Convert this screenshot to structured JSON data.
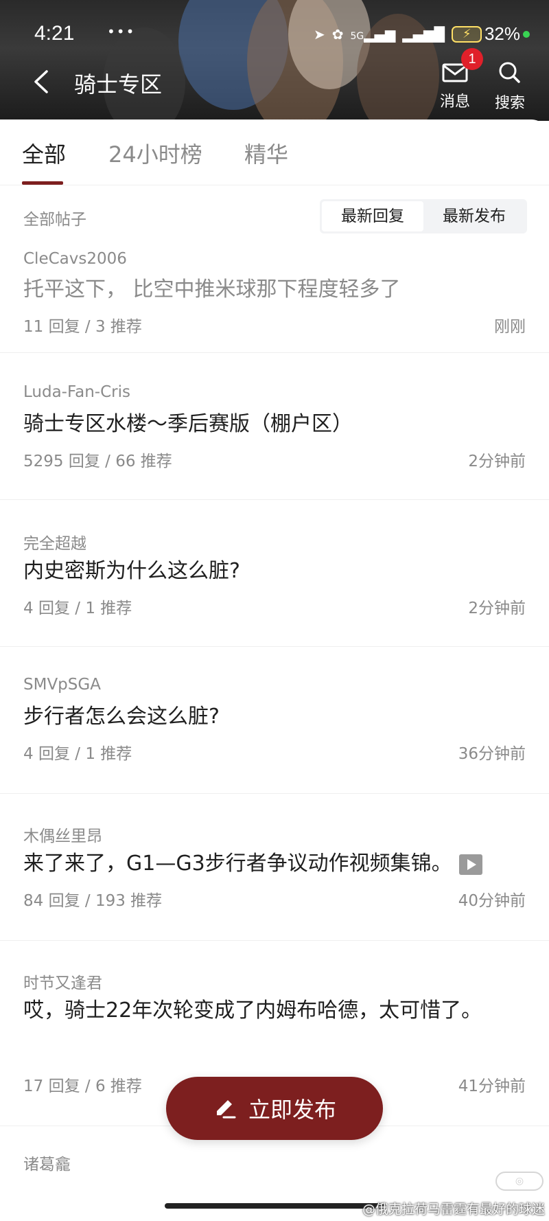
{
  "status_bar": {
    "time": "4:21",
    "dots": "•••",
    "network_label": "5G",
    "battery_percent": "32%"
  },
  "header": {
    "back_icon": "chevron-left-icon",
    "title": "骑士专区",
    "message_label": "消息",
    "message_badge": "1",
    "search_label": "搜索"
  },
  "tabs": [
    {
      "label": "全部",
      "active": true
    },
    {
      "label": "24小时榜",
      "active": false
    },
    {
      "label": "精华",
      "active": false
    }
  ],
  "filter": {
    "label": "全部帖子",
    "options": [
      "最新回复",
      "最新发布"
    ],
    "selected": "最新回复"
  },
  "posts": [
    {
      "author": "CleCavs2006",
      "title": "托平这下， 比空中推米球那下程度轻多了",
      "stats": "11 回复 / 3 推荐",
      "time": "刚刚",
      "read": true
    },
    {
      "author": "Luda-Fan-Cris",
      "title": "骑士专区水楼～季后赛版（棚户区）",
      "stats": "5295 回复 / 66 推荐",
      "time": "2分钟前",
      "read": false
    },
    {
      "author": "完全超越",
      "title": "内史密斯为什么这么脏?",
      "stats": "4 回复 / 1 推荐",
      "time": "2分钟前",
      "read": false
    },
    {
      "author": "SMVpSGA",
      "title": "步行者怎么会这么脏?",
      "stats": "4 回复 / 1 推荐",
      "time": "36分钟前",
      "read": false
    },
    {
      "author": "木偶丝里昂",
      "title": "来了来了，G1—G3步行者争议动作视频集锦。",
      "stats": "84 回复 / 193 推荐",
      "time": "40分钟前",
      "read": false,
      "video": true
    },
    {
      "author": "时节又逢君",
      "title": "哎，骑士22年次轮变成了内姆布哈德，太可惜了。",
      "stats": "17 回复 / 6 推荐",
      "time": "41分钟前",
      "read": false
    },
    {
      "author": "诸葛龕",
      "title": "",
      "stats": "",
      "time": "",
      "read": false
    }
  ],
  "fab": {
    "label": "立即发布",
    "icon": "pen-icon"
  },
  "watermark": "@俄克拉荷马雷霆有最好的球迷",
  "colors": {
    "accent": "#7d1f1f",
    "badge": "#e0202a",
    "muted": "#8a8a8a"
  }
}
